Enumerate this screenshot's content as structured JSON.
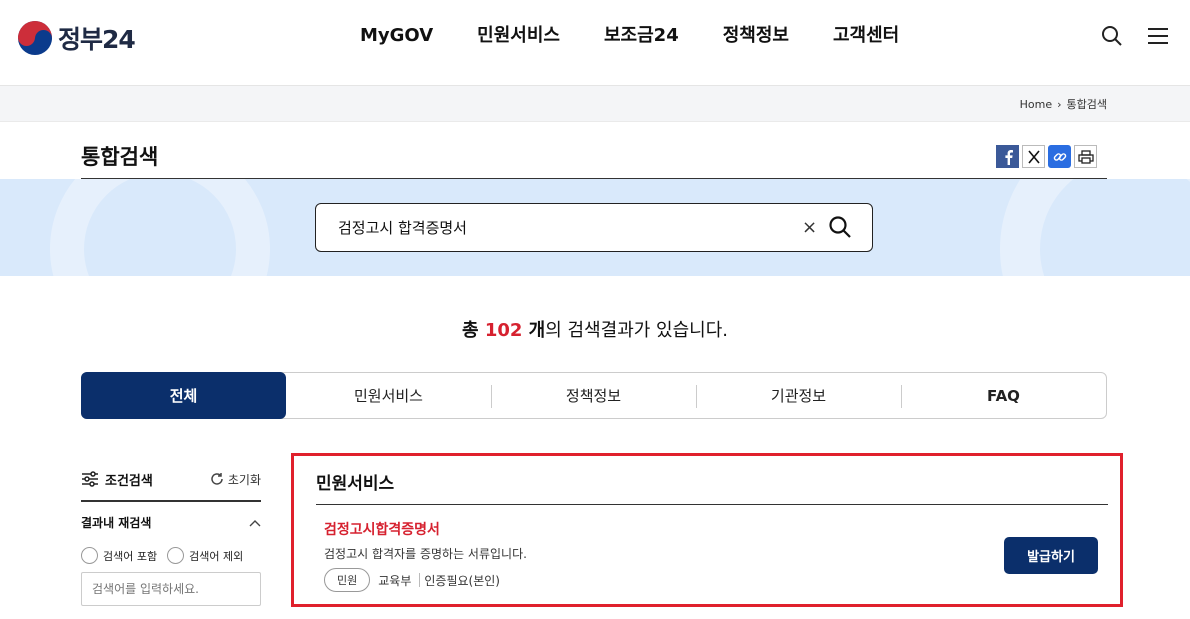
{
  "header": {
    "logo_text": "정부24",
    "nav": [
      "MyGOV",
      "민원서비스",
      "보조금24",
      "정책정보",
      "고객센터"
    ]
  },
  "breadcrumb": {
    "home": "Home",
    "sep": "›",
    "current": "통합검색"
  },
  "page": {
    "title": "통합검색"
  },
  "search": {
    "query": "검정고시 합격증명서",
    "clear": "×"
  },
  "results": {
    "prefix": "총 ",
    "count": "102",
    "unit": " 개",
    "suffix": "의 검색결과가 있습니다."
  },
  "tabs": [
    "전체",
    "민원서비스",
    "정책정보",
    "기관정보",
    "FAQ"
  ],
  "sidebar": {
    "title": "조건검색",
    "reset": "초기화",
    "section": "결과내 재검색",
    "radio_include": "검색어 포함",
    "radio_exclude": "검색어 제외",
    "input_placeholder": "검색어를 입력하세요."
  },
  "panel": {
    "title": "민원서비스",
    "item": {
      "title": "검정고시합격증명서",
      "desc": "검정고시 합격자를 증명하는 서류입니다.",
      "tag": "민원",
      "org": "교육부",
      "auth": "인증필요(본인)",
      "button": "발급하기"
    }
  },
  "colors": {
    "primary": "#0b2f6b",
    "accent": "#d6212f",
    "band": "#d9e9fb"
  }
}
